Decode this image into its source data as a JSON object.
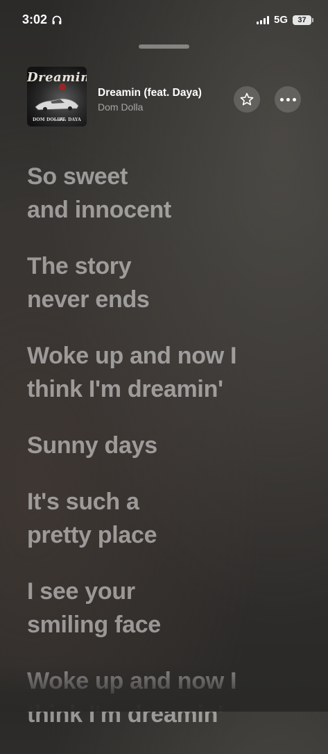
{
  "status_bar": {
    "time": "3:02",
    "network": "5G",
    "battery": "37",
    "icons": [
      "headphones-icon",
      "signal-icon"
    ]
  },
  "now_playing": {
    "title": "Dreamin (feat. Daya)",
    "artist": "Dom Dolla",
    "album_art": {
      "title_text": "Dreamin",
      "artist_text": "DOM DOLLA",
      "feat_text": "FT. DAYA"
    },
    "favorite_icon": "star-icon",
    "more_icon": "ellipsis-icon"
  },
  "lyrics": [
    "So sweet\nand innocent",
    "The story\nnever ends",
    "Woke up and now I\nthink I'm dreamin'",
    "Sunny days",
    "It's such a\npretty place",
    "I see your\nsmiling face",
    "Woke up and now I\nthink I'm dreamin'"
  ]
}
